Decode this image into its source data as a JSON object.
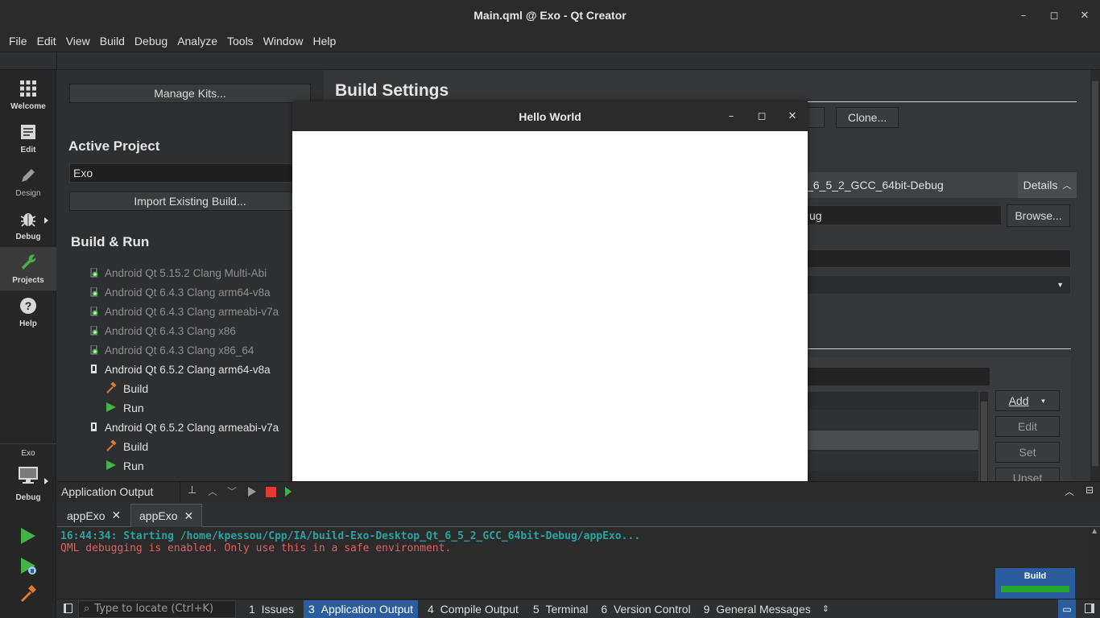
{
  "window": {
    "title": "Main.qml @ Exo - Qt Creator",
    "controls": [
      "–",
      "◻",
      "✕"
    ]
  },
  "menu": [
    "File",
    "Edit",
    "View",
    "Build",
    "Debug",
    "Analyze",
    "Tools",
    "Window",
    "Help"
  ],
  "modes": [
    {
      "label": "Welcome",
      "icon": "grid-icon"
    },
    {
      "label": "Edit",
      "icon": "document-icon"
    },
    {
      "label": "Design",
      "icon": "pen-icon"
    },
    {
      "label": "Debug",
      "icon": "bug-icon"
    },
    {
      "label": "Projects",
      "icon": "wrench-icon"
    },
    {
      "label": "Help",
      "icon": "help-icon"
    }
  ],
  "target_selector": {
    "project": "Exo",
    "mode": "Debug"
  },
  "left_panel": {
    "manage_kits": "Manage Kits...",
    "active_project_heading": "Active Project",
    "active_project": "Exo",
    "import_build": "Import Existing Build...",
    "build_run_heading": "Build & Run",
    "kits": [
      {
        "name": "Android Qt 5.15.2 Clang Multi-Abi",
        "enabled": false
      },
      {
        "name": "Android Qt 6.4.3 Clang arm64-v8a",
        "enabled": false
      },
      {
        "name": "Android Qt 6.4.3 Clang armeabi-v7a",
        "enabled": false
      },
      {
        "name": "Android Qt 6.4.3 Clang x86",
        "enabled": false
      },
      {
        "name": "Android Qt 6.4.3 Clang x86_64",
        "enabled": false
      },
      {
        "name": "Android Qt 6.5.2 Clang arm64-v8a",
        "enabled": true
      },
      {
        "name": "Android Qt 6.5.2 Clang armeabi-v7a",
        "enabled": true
      }
    ],
    "build_label": "Build",
    "run_label": "Run"
  },
  "build_settings": {
    "heading": "Build Settings",
    "rename_tail": "e...",
    "clone": "Clone...",
    "config_tail": "_6_5_2_GCC_64bit-Debug",
    "details": "Details",
    "dir_tail": "ug",
    "browse": "Browse...",
    "add": "Add",
    "edit": "Edit",
    "set": "Set",
    "unset": "Unset"
  },
  "dialog": {
    "title": "Hello World"
  },
  "output": {
    "pane_title": "Application Output",
    "tabs": [
      "appExo",
      "appExo"
    ],
    "line1": "16:44:34: Starting /home/kpessou/Cpp/IA/build-Exo-Desktop_Qt_6_5_2_GCC_64bit-Debug/appExo...",
    "line2": "QML debugging is enabled. Only use this in a safe environment."
  },
  "status": {
    "locate_placeholder": "Type to locate (Ctrl+K)",
    "panes": [
      {
        "num": "1",
        "label": "Issues"
      },
      {
        "num": "3",
        "label": "Application Output"
      },
      {
        "num": "4",
        "label": "Compile Output"
      },
      {
        "num": "5",
        "label": "Terminal"
      },
      {
        "num": "6",
        "label": "Version Control"
      },
      {
        "num": "9",
        "label": "General Messages"
      }
    ]
  },
  "build_progress": {
    "label": "Build",
    "fraction": 1.0,
    "color": "#27a72d"
  },
  "colors": {
    "accent": "#2b5c9e",
    "run_green": "#44b244",
    "output_cyan": "#28a2a2",
    "output_red": "#e06060"
  }
}
